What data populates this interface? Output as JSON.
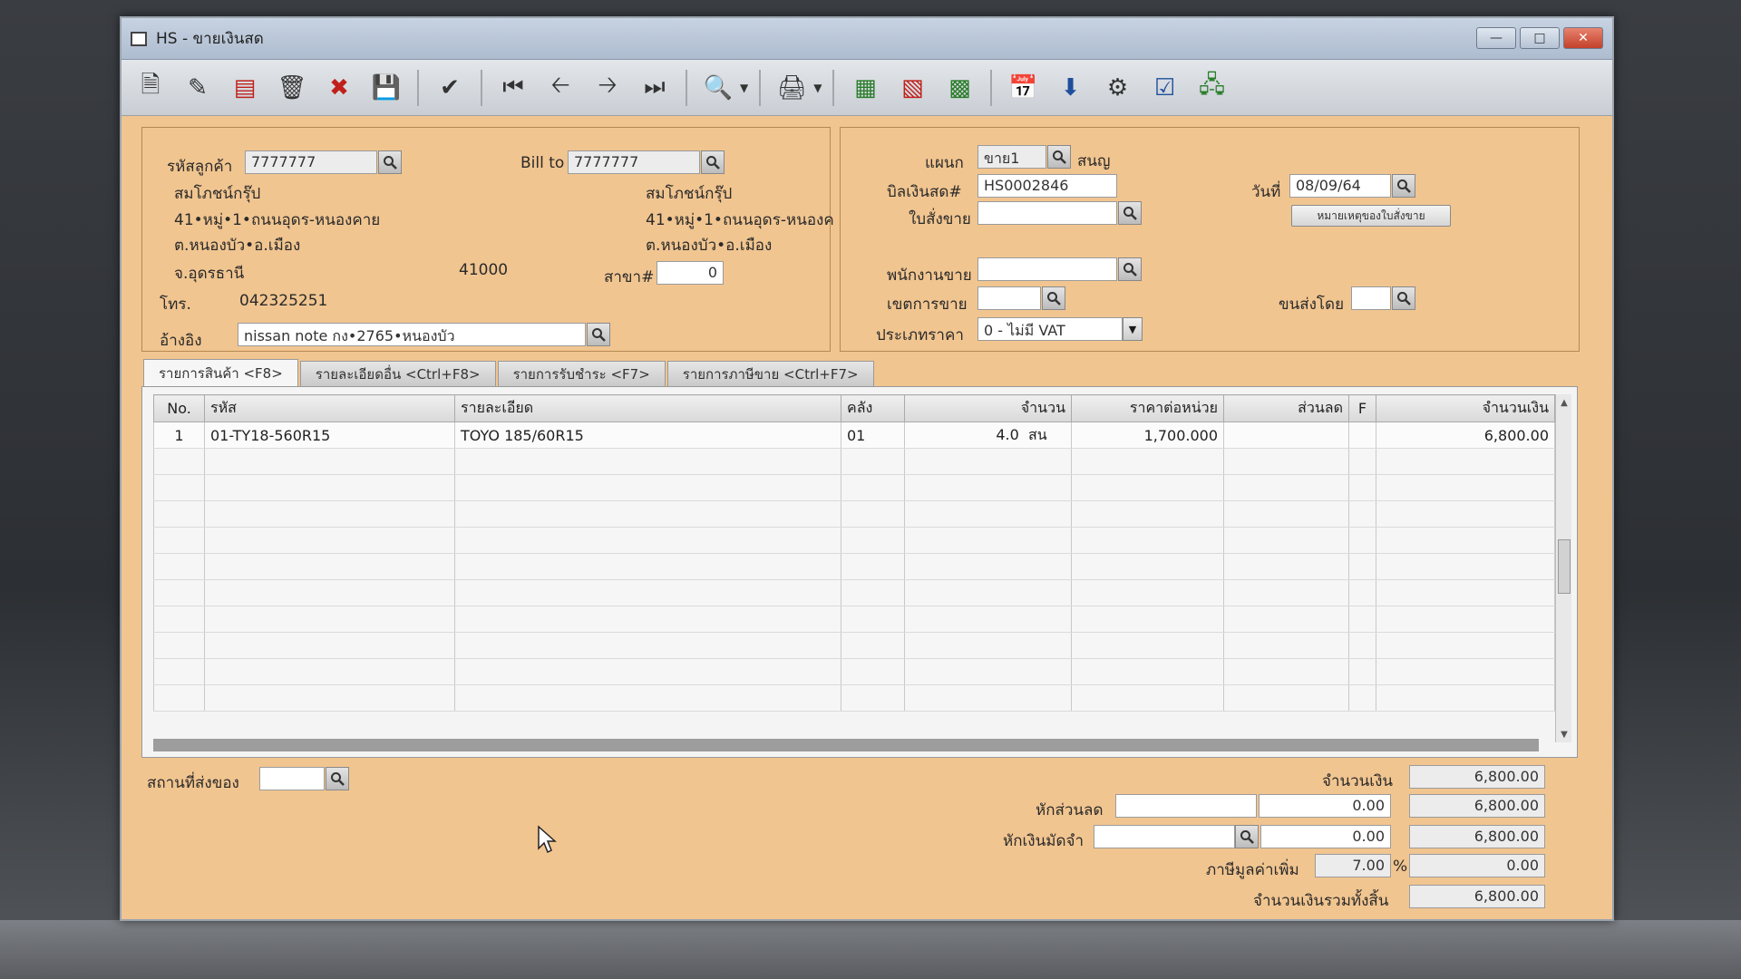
{
  "window": {
    "title": "HS - ขายเงินสด"
  },
  "toolbar": {
    "buttons": [
      "new",
      "edit",
      "cancel-doc",
      "delete",
      "close",
      "save",
      "approve",
      "first",
      "prev",
      "next",
      "last",
      "find",
      "print",
      "import",
      "export",
      "post",
      "calendar",
      "download",
      "tool",
      "ok",
      "network"
    ]
  },
  "customer": {
    "code_label": "รหัสลูกค้า",
    "code": "7777777",
    "name": "สมโภชน์กรุ๊ป",
    "addr1": "41•หมู่•1•ถนนอุดร-หนองคาย",
    "addr2": "ต.หนองบัว•อ.เมือง",
    "addr3": "จ.อุดรธานี",
    "zip": "41000",
    "phone_label": "โทร.",
    "phone": "042325251",
    "ref_label": "อ้างอิง",
    "ref": "nissan note กง•2765•หนองบัว"
  },
  "billto": {
    "label": "Bill to",
    "code": "7777777",
    "name": "สมโภชน์กรุ๊ป",
    "addr1": "41•หมู่•1•ถนนอุดร-หนองค",
    "addr2": "ต.หนองบัว•อ.เมือง",
    "branch_label": "สาขา#",
    "branch": "0"
  },
  "doc": {
    "dept_label": "แผนก",
    "dept": "ขาย1",
    "dept_name": "สนญ",
    "bill_label": "บิลเงินสด#",
    "bill_no": "HS0002846",
    "date_label": "วันที่",
    "date": "08/09/64",
    "order_label": "ใบสั่งขาย",
    "order": "",
    "note_button": "หมายเหตุของใบสั่งขาย",
    "salesman_label": "พนักงานขาย",
    "salesman": "",
    "area_label": "เขตการขาย",
    "area": "",
    "ship_label": "ขนส่งโดย",
    "ship": "",
    "price_type_label": "ประเภทราคา",
    "price_type": "0 - ไม่มี VAT"
  },
  "tabs": [
    "รายการสินค้า <F8>",
    "รายละเอียดอื่น <Ctrl+F8>",
    "รายการรับชำระ <F7>",
    "รายการภาษีขาย <Ctrl+F7>"
  ],
  "grid": {
    "headers": [
      "No.",
      "รหัส",
      "รายละเอียด",
      "คลัง",
      "จำนวน",
      "ราคาต่อหน่วย",
      "ส่วนลด",
      "F",
      "จำนวนเงิน"
    ],
    "rows": [
      {
        "no": "1",
        "code": "01-TY18-560R15",
        "desc": "TOYO 185/60R15",
        "wh": "01",
        "qty": "4.0",
        "unit": "สน",
        "price": "1,700.000",
        "disc": "",
        "f": "",
        "amount": "6,800.00"
      }
    ]
  },
  "footer": {
    "delivery_label": "สถานที่ส่งของ",
    "delivery": "",
    "amount_label": "จำนวนเงิน",
    "amount": "6,800.00",
    "discount_label": "หักส่วนลด",
    "discount_text": "",
    "discount": "0.00",
    "after_discount": "6,800.00",
    "deposit_label": "หักเงินมัดจำ",
    "deposit_text": "",
    "deposit": "0.00",
    "after_deposit": "6,800.00",
    "vat_label": "ภาษีมูลค่าเพิ่ม",
    "vat_rate": "7.00",
    "vat_pct": "%",
    "vat": "0.00",
    "total_label": "จำนวนเงินรวมทั้งสิ้น",
    "total": "6,800.00"
  }
}
